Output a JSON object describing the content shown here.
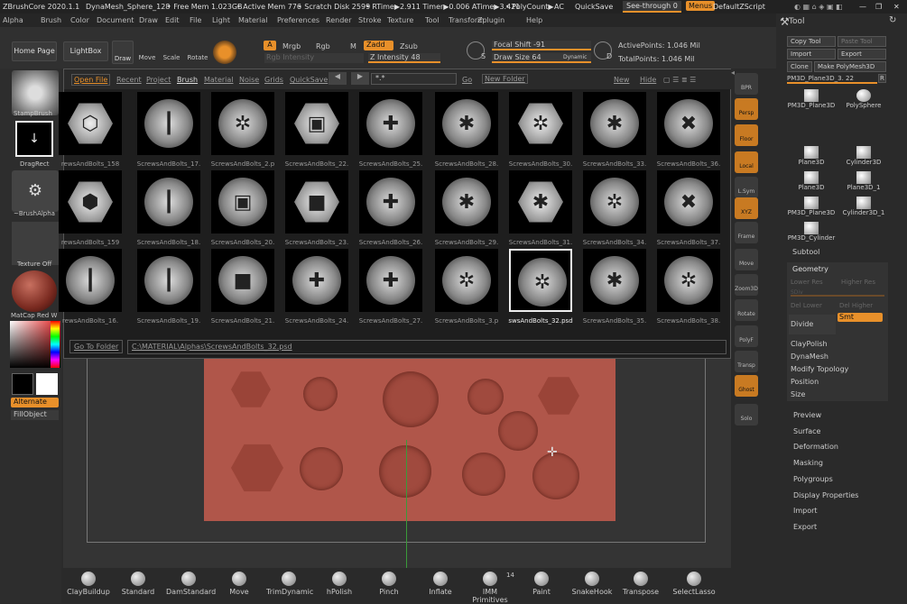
{
  "titlebar": {
    "app": "ZBrushCore 2020.1.1",
    "doc": "DynaMesh_Sphere_128",
    "free_mem": "• Free Mem 1.023GB",
    "active_mem": "• Active Mem 776",
    "scratch": "• Scratch Disk 2599",
    "rtime": "• RTime▶2.911 Timer▶0.006 ATime▶3.421",
    "polycount": "• PolyCount▶",
    "ac": "AC",
    "quicksave": "QuickSave",
    "see_through": "See-through 0",
    "menus": "Menus",
    "script": "DefaultZScript"
  },
  "menubar": [
    "Alpha",
    "Brush",
    "Color",
    "Document",
    "Draw",
    "Edit",
    "File",
    "Light",
    "Material",
    "Preferences",
    "Render",
    "Stroke",
    "Texture",
    "Tool",
    "Transform",
    "Zplugin",
    "Help"
  ],
  "topshelf": {
    "home": "Home Page",
    "lightbox": "LightBox",
    "draw": "Draw",
    "move": "Move",
    "scale": "Scale",
    "rotate": "Rotate",
    "a": "A",
    "mrgb": "Mrgb",
    "rgb": "Rgb",
    "m": "M",
    "zadd": "Zadd",
    "zsub": "Zsub",
    "rgb_intensity": "Rgb Intensity",
    "z_intensity": "Z Intensity 48",
    "focal_shift": "Focal Shift -91",
    "draw_size": "Draw Size 64",
    "dynamic": "Dynamic",
    "s": "S",
    "d": "D",
    "active_points": "ActivePoints: 1.046 Mil",
    "total_points": "TotalPoints: 1.046 Mil"
  },
  "leftshelf": {
    "stamp": "StampBrush",
    "drag": "DragRect",
    "alpha": "~BrushAlpha",
    "texture": "Texture Off",
    "matcap": "MatCap Red W",
    "alternate": "Alternate",
    "fillobject": "FillObject"
  },
  "popup": {
    "tabs": [
      "Open File",
      "Recent",
      "Project",
      "Brush",
      "Material",
      "Noise",
      "Grids",
      "QuickSave"
    ],
    "search": "*.*",
    "go": "Go",
    "new_folder": "New Folder",
    "new": "New",
    "hide": "Hide",
    "goto": "Go To Folder",
    "path": "C:\\MATERIAL\\Alphas\\ScrewsAndBolts_32.psd",
    "thumbs": [
      [
        "rewsAndBolts_158",
        "ScrewsAndBolts_17.",
        "ScrewsAndBolts_2.p",
        "ScrewsAndBolts_22.",
        "ScrewsAndBolts_25.",
        "ScrewsAndBolts_28.",
        "ScrewsAndBolts_30.",
        "ScrewsAndBolts_33.",
        "ScrewsAndBolts_36."
      ],
      [
        "rewsAndBolts_159",
        "ScrewsAndBolts_18.",
        "ScrewsAndBolts_20.",
        "ScrewsAndBolts_23.",
        "ScrewsAndBolts_26.",
        "ScrewsAndBolts_29.",
        "ScrewsAndBolts_31.",
        "ScrewsAndBolts_34.",
        "ScrewsAndBolts_37."
      ],
      [
        "rewsAndBolts_16.",
        "ScrewsAndBolts_19.",
        "ScrewsAndBolts_21.",
        "ScrewsAndBolts_24.",
        "ScrewsAndBolts_27.",
        "ScrewsAndBolts_3.p",
        "swsAndBolts_32.psd",
        "ScrewsAndBolts_35.",
        "ScrewsAndBolts_38."
      ]
    ]
  },
  "rightdock": [
    "BPR",
    "Persp",
    "Floor",
    "Local",
    "L.Sym",
    "XYZ",
    "Frame",
    "Move",
    "Zoom3D",
    "Rotate",
    "PolyF",
    "Transp",
    "Ghost",
    "Solo"
  ],
  "toolpanel": {
    "title": "Tool",
    "copy": "Copy Tool",
    "paste": "Paste Tool",
    "import": "Import",
    "export": "Export",
    "clone": "Clone",
    "make": "Make PolyMesh3D",
    "current": "PM3D_Plane3D_3. 22",
    "r": "R",
    "tools": [
      "PM3D_Plane3D",
      "PolySphere",
      "Plane3D",
      "Cylinder3D",
      "Plane3D",
      "Plane3D_1",
      "PM3D_Plane3D",
      "Cylinder3D_1",
      "PM3D_Cylinder",
      "PM3D_Plane3D",
      "PM3D_Plane3D"
    ],
    "subtool": "Subtool",
    "geometry": "Geometry",
    "lower": "Lower Res",
    "higher": "Higher Res",
    "sdiv": "SDiv",
    "del_lower": "Del Lower",
    "del_higher": "Del Higher",
    "divide": "Divide",
    "smt": "Smt",
    "geo_items": [
      "ClayPolish",
      "DynaMesh",
      "Modify Topology",
      "Position",
      "Size"
    ],
    "sections": [
      "Preview",
      "Surface",
      "Deformation",
      "Masking",
      "Polygroups",
      "Display Properties",
      "Import",
      "Export"
    ]
  },
  "brushes": [
    "ClayBuildup",
    "Standard",
    "DamStandard",
    "Move",
    "TrimDynamic",
    "hPolish",
    "Pinch",
    "Inflate",
    "IMM Primitives",
    "Paint",
    "SnakeHook",
    "Transpose",
    "SelectLasso"
  ],
  "imm_count": "14"
}
